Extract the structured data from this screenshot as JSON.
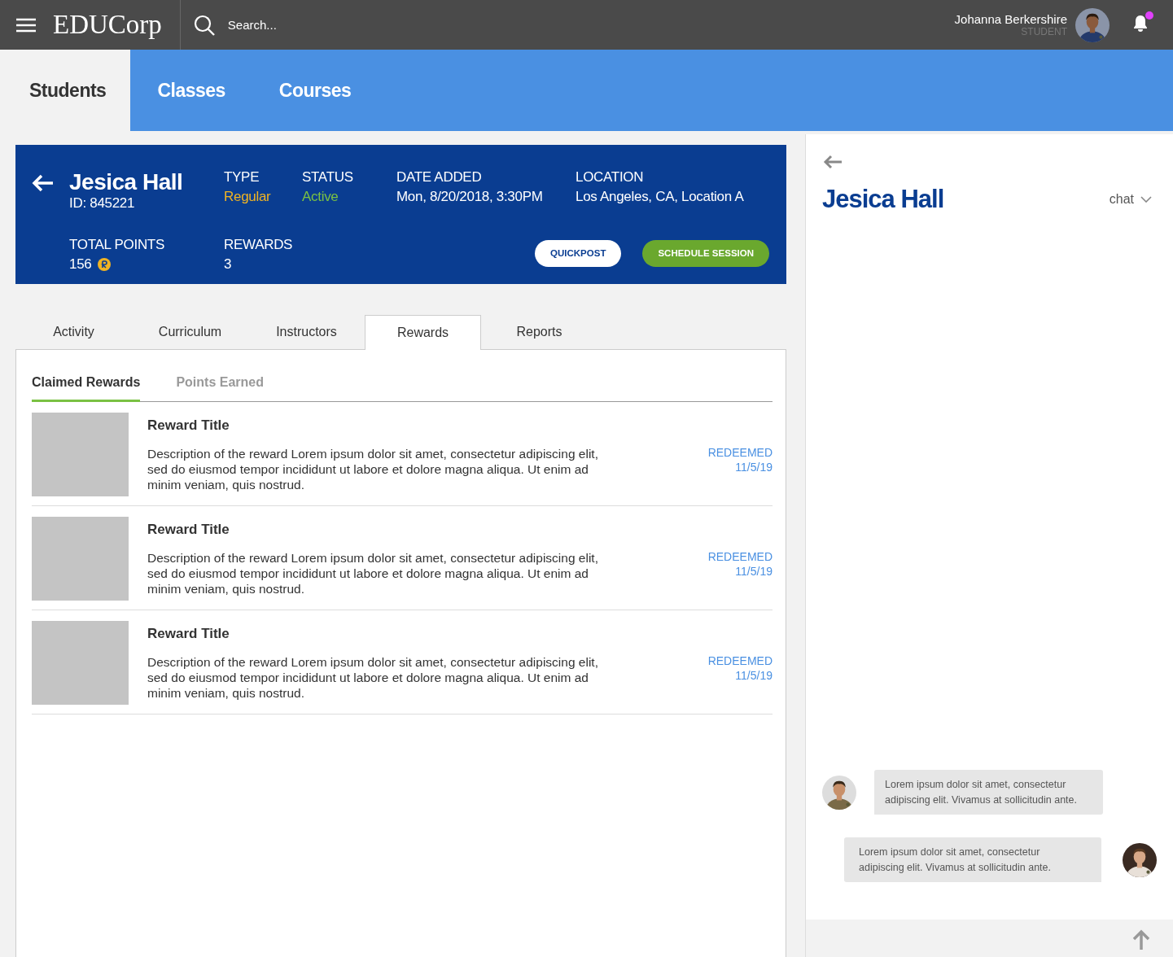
{
  "topbar": {
    "logo": "EDUCorp",
    "search": {
      "placeholder": "Search..."
    },
    "user": {
      "name": "Johanna Berkershire",
      "role": "STUDENT"
    },
    "notification_dot": true
  },
  "nav": [
    {
      "label": "Students",
      "selected": true
    },
    {
      "label": "Classes",
      "selected": false
    },
    {
      "label": "Courses",
      "selected": false
    }
  ],
  "student": {
    "name": "Jesica Hall",
    "id": "ID: 845221",
    "fields": [
      {
        "label": "TYPE",
        "value": "Regular",
        "kind": "type"
      },
      {
        "label": "STATUS",
        "value": "Active",
        "kind": "status"
      },
      {
        "label": "DATE ADDED",
        "value": "Mon, 8/20/2018, 3:30PM",
        "kind": "plain"
      },
      {
        "label": "LOCATION",
        "value": "Los Angeles, CA, Location A",
        "kind": "plain"
      }
    ],
    "total_points": {
      "label": "TOTAL POINTS",
      "value": "156"
    },
    "rewards": {
      "label": "REWARDS",
      "value": "3"
    },
    "buttons": [
      {
        "label": "QUICKPOST",
        "kind": "outline"
      },
      {
        "label": "SCHEDULE SESSION",
        "kind": "primary"
      }
    ]
  },
  "tabs": [
    {
      "label": "Activity",
      "selected": false
    },
    {
      "label": "Curriculum",
      "selected": false
    },
    {
      "label": "Instructors",
      "selected": false
    },
    {
      "label": "Rewards",
      "selected": true
    },
    {
      "label": "Reports",
      "selected": false
    }
  ],
  "subtabs": [
    {
      "label": "Claimed Rewards",
      "selected": true
    },
    {
      "label": "Points Earned",
      "selected": false
    }
  ],
  "rewards": [
    {
      "title": "Reward Title",
      "description": "Description of the reward Lorem ipsum dolor sit amet, consectetur adipiscing elit, sed do eiusmod tempor incididunt ut labore et dolore magna aliqua. Ut enim ad minim veniam, quis nostrud.",
      "status": "REDEEMED",
      "date": "11/5/19"
    },
    {
      "title": "Reward Title",
      "description": "Description of the reward Lorem ipsum dolor sit amet, consectetur adipiscing elit, sed do eiusmod tempor incididunt ut labore et dolore magna aliqua. Ut enim ad minim veniam, quis nostrud.",
      "status": "REDEEMED",
      "date": "11/5/19"
    },
    {
      "title": "Reward Title",
      "description": "Description of the reward Lorem ipsum dolor sit amet, consectetur adipiscing elit, sed do eiusmod tempor incididunt ut labore et dolore magna aliqua. Ut enim ad minim veniam, quis nostrud.",
      "status": "REDEEMED",
      "date": "11/5/19"
    }
  ],
  "chat": {
    "name": "Jesica Hall",
    "mode": "chat",
    "messages": [
      {
        "text": "Lorem ipsum dolor sit amet, consectetur adipiscing elit. Vivamus at sollicitudin ante.",
        "kind": "incoming"
      },
      {
        "text": "Lorem ipsum dolor sit amet, consectetur adipiscing elit. Vivamus at sollicitudin ante.",
        "kind": "outgoing"
      }
    ]
  }
}
